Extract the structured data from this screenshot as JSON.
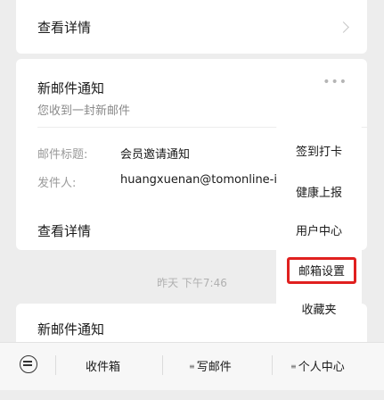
{
  "top_card": {
    "view_details": "查看详情"
  },
  "notification": {
    "title": "新邮件通知",
    "subtitle": "您收到一封新邮件",
    "more": "•••",
    "rows": [
      {
        "label": "邮件标题:",
        "value": "会员邀请通知"
      },
      {
        "label": "发件人:",
        "value": "huangxuenan@tomonline-i"
      }
    ],
    "view_details": "查看详情"
  },
  "timestamp": "昨天 下午7:46",
  "next_card": {
    "title": "新邮件通知"
  },
  "popup_menu": {
    "items": [
      {
        "label": "签到打卡"
      },
      {
        "label": "健康上报"
      },
      {
        "label": "用户中心"
      },
      {
        "label": "邮箱设置",
        "highlighted": true
      },
      {
        "label": "收藏夹"
      }
    ],
    "highlight_color": "#e0201f"
  },
  "bottom_bar": {
    "tabs": [
      {
        "label": "收件箱"
      },
      {
        "label": "写邮件"
      },
      {
        "label": "个人中心"
      }
    ],
    "menu_glyph": "≡"
  }
}
